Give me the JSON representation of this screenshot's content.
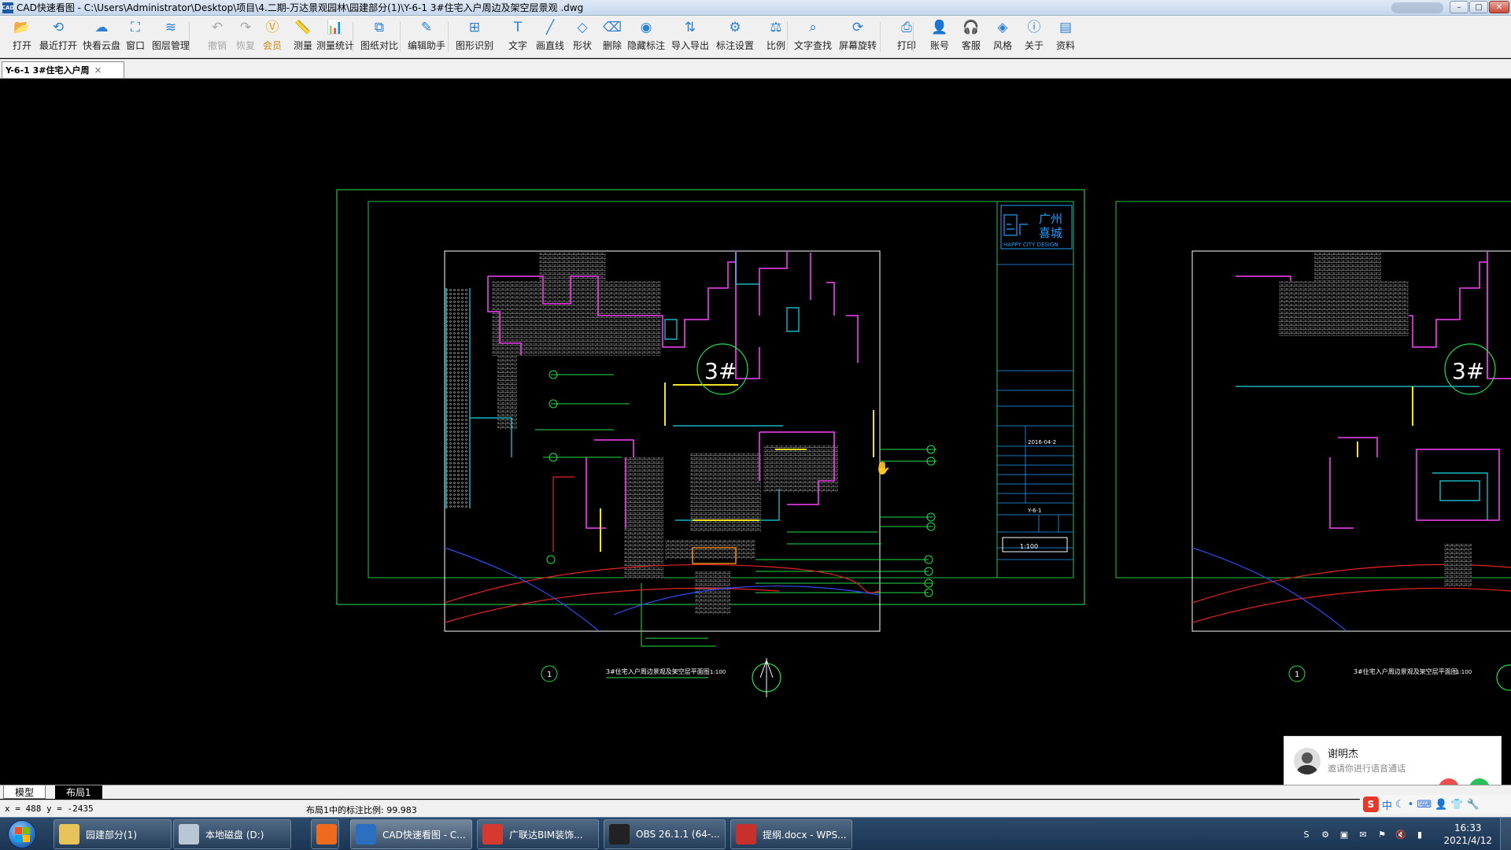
{
  "window": {
    "app_logo": "CAD",
    "title": "CAD快速看图 - C:\\Users\\Administrator\\Desktop\\项目\\4.二期-万达景观园林\\园建部分(1)\\Y-6-1  3#住宅入户周边及架空层景观 .dwg",
    "min_label": "–",
    "max_label": "□",
    "close_label": "✕"
  },
  "toolbar": [
    {
      "label": "打开",
      "icon": "folder-open-icon",
      "glyph": "📂"
    },
    {
      "label": "最近打开",
      "icon": "history-icon",
      "glyph": "⟲"
    },
    {
      "label": "快看云盘",
      "icon": "cloud-icon",
      "glyph": "☁"
    },
    {
      "label": "窗口",
      "icon": "window-icon",
      "glyph": "⛶"
    },
    {
      "label": "图层管理",
      "icon": "layers-icon",
      "glyph": "≋"
    },
    {
      "label": "撤销",
      "icon": "undo-icon",
      "glyph": "↶",
      "disabled": true
    },
    {
      "label": "恢复",
      "icon": "redo-icon",
      "glyph": "↷",
      "disabled": true
    },
    {
      "label": "会员",
      "icon": "vip-icon",
      "glyph": "Ⓥ",
      "vip": true
    },
    {
      "label": "测量",
      "icon": "ruler-icon",
      "glyph": "📏"
    },
    {
      "label": "测量统计",
      "icon": "measure-stats-icon",
      "glyph": "📊"
    },
    {
      "label": "图纸对比",
      "icon": "compare-icon",
      "glyph": "⧉"
    },
    {
      "label": "编辑助手",
      "icon": "edit-assistant-icon",
      "glyph": "✎"
    },
    {
      "label": "图形识别",
      "icon": "shape-recognition-icon",
      "glyph": "⊞"
    },
    {
      "label": "文字",
      "icon": "text-icon",
      "glyph": "T"
    },
    {
      "label": "画直线",
      "icon": "line-icon",
      "glyph": "╱"
    },
    {
      "label": "形状",
      "icon": "shape-icon",
      "glyph": "◇"
    },
    {
      "label": "删除",
      "icon": "eraser-icon",
      "glyph": "⌫"
    },
    {
      "label": "隐藏标注",
      "icon": "hide-annotation-icon",
      "glyph": "◉"
    },
    {
      "label": "导入导出",
      "icon": "import-export-icon",
      "glyph": "⇅"
    },
    {
      "label": "标注设置",
      "icon": "annotation-settings-icon",
      "glyph": "⚙"
    },
    {
      "label": "比例",
      "icon": "scale-icon",
      "glyph": "⚖"
    },
    {
      "label": "文字查找",
      "icon": "text-search-icon",
      "glyph": "⌕"
    },
    {
      "label": "屏幕旋转",
      "icon": "rotate-screen-icon",
      "glyph": "⟳"
    },
    {
      "label": "打印",
      "icon": "printer-icon",
      "glyph": "⎙"
    },
    {
      "label": "账号",
      "icon": "account-icon",
      "glyph": "👤"
    },
    {
      "label": "客服",
      "icon": "headset-icon",
      "glyph": "🎧"
    },
    {
      "label": "风格",
      "icon": "style-icon",
      "glyph": "◈"
    },
    {
      "label": "关于",
      "icon": "info-icon",
      "glyph": "ⓘ"
    },
    {
      "label": "资料",
      "icon": "documents-icon",
      "glyph": "▤"
    }
  ],
  "doc_tab": {
    "label": "Y-6-1  3#住宅入户周",
    "close": "×"
  },
  "drawing": {
    "logo_line1": "广州",
    "logo_line2": "喜城",
    "logo_en": "HAPPY CITY DESIGN",
    "room_label": "3#",
    "sheet_no": "1",
    "title_left": "3#住宅入户周边景观及架空层平面图",
    "title_right": "3#住宅入户周边景观及架空层平面图",
    "scale_label": "1:100",
    "date_value": "2016-04-2",
    "drawing_no_value": "Y-6-1"
  },
  "notification": {
    "name": "谢明杰",
    "message": "邀请你进行语音通话",
    "decline": "✆",
    "accept": "✆"
  },
  "layout_tabs": [
    {
      "label": "模型"
    },
    {
      "label": "布局1"
    }
  ],
  "status": {
    "coords": "x = 488  y = -2435",
    "scale_text": "布局1中的标注比例: 99.983"
  },
  "ime": {
    "logo": "S",
    "items": [
      "中",
      "☾",
      "•",
      "⌨",
      "👤",
      "👕",
      "🔧"
    ]
  },
  "taskbar": {
    "start_icon": "windows-start-icon",
    "tasks": [
      {
        "label": "园建部分(1)",
        "icon": "folder-icon",
        "color": "#e7c35a"
      },
      {
        "label": "本地磁盘 (D:)",
        "icon": "drive-icon",
        "color": "#b9c6d3"
      },
      {
        "label": "",
        "icon": "firefox-icon",
        "color": "#f06a1d"
      },
      {
        "label": "CAD快速看图 - C...",
        "icon": "cad-icon",
        "color": "#2c6fc0",
        "active": true
      },
      {
        "label": "广联达BIM装饰...",
        "icon": "glodon-icon",
        "color": "#d43a2f"
      },
      {
        "label": "OBS 26.1.1 (64-...",
        "icon": "obs-icon",
        "color": "#222222"
      },
      {
        "label": "提纲.docx - WPS...",
        "icon": "wps-icon",
        "color": "#c8302b"
      }
    ],
    "tray_icons": [
      "S",
      "⚙",
      "▣",
      "✉",
      "⚑",
      "🔇",
      "▮"
    ],
    "time": "16:33",
    "date": "2021/4/12"
  }
}
